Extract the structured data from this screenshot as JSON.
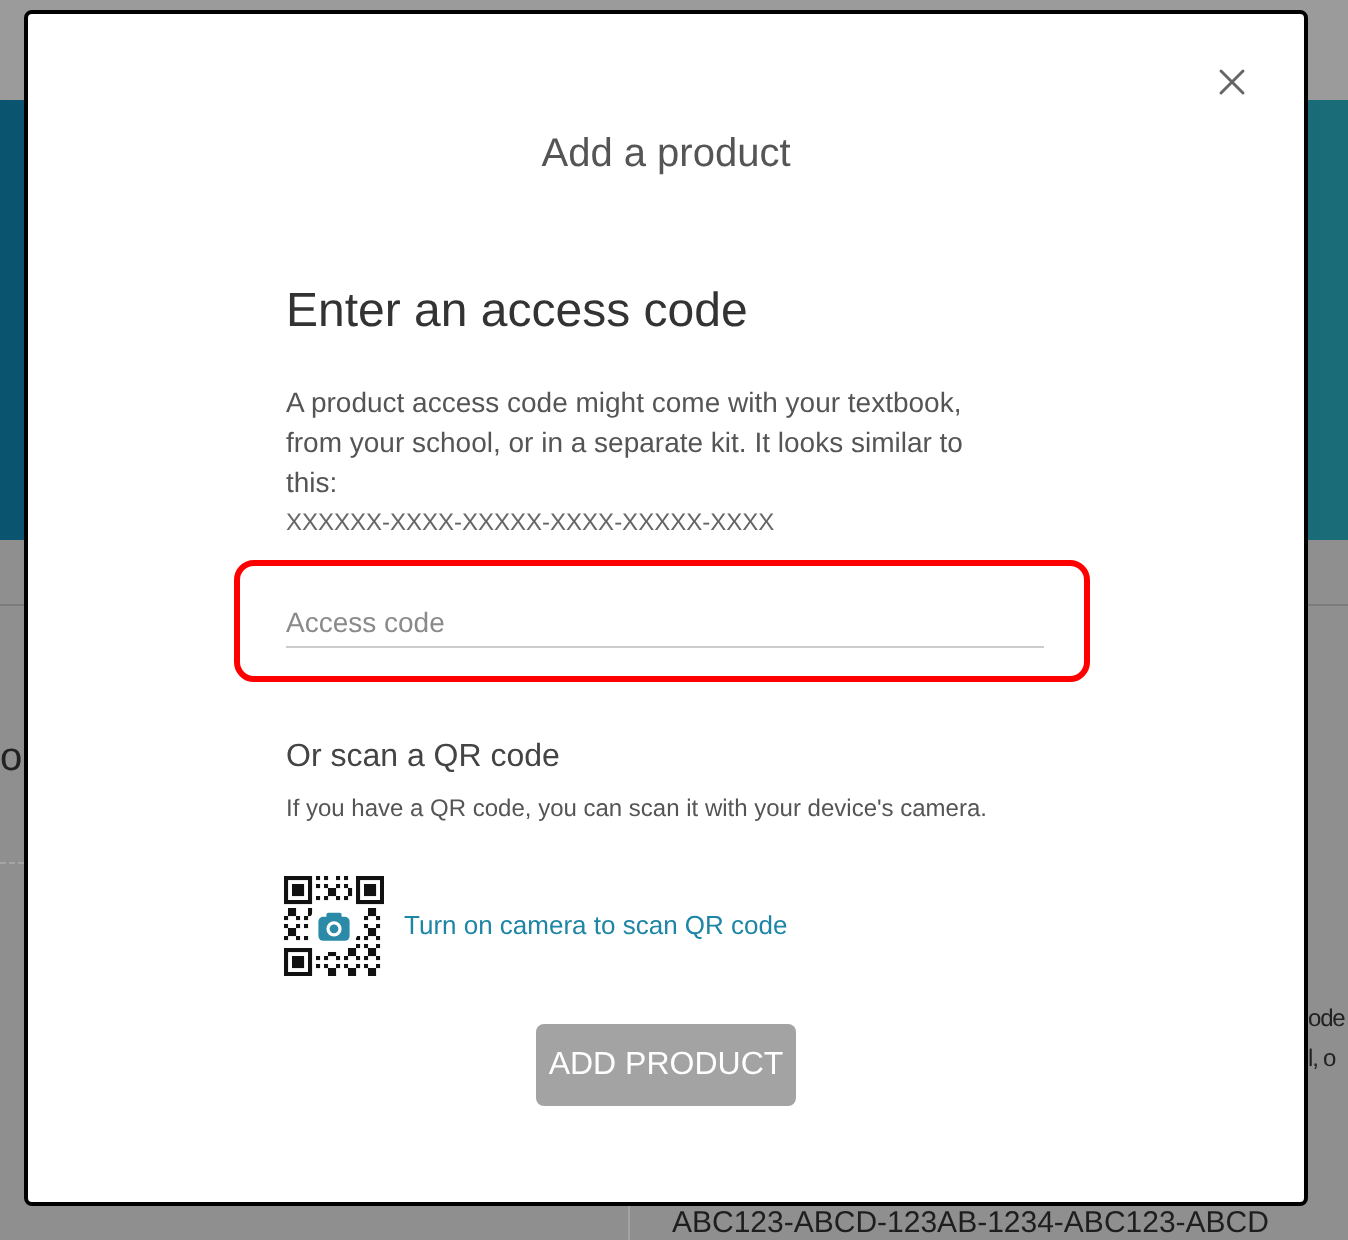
{
  "background": {
    "left_text": "o",
    "right_lines": [
      "ode",
      "l, o"
    ],
    "bottom_text": "ABC123-ABCD-123AB-1234-ABC123-ABCD"
  },
  "dialog": {
    "title": "Add a product",
    "access_code": {
      "heading": "Enter an access code",
      "description": "A product access code might come with your textbook, from your school, or in a separate kit. It looks similar to this:",
      "example": "XXXXXX-XXXX-XXXXX-XXXX-XXXXX-XXXX",
      "field": {
        "placeholder": "Access code",
        "highlighted": true
      }
    },
    "qr": {
      "heading": "Or scan a QR code",
      "description": "If you have a QR code, you can scan it with your device's camera.",
      "link": "Turn on camera to scan QR code"
    },
    "submit": {
      "label": "ADD PRODUCT",
      "disabled": true
    }
  }
}
